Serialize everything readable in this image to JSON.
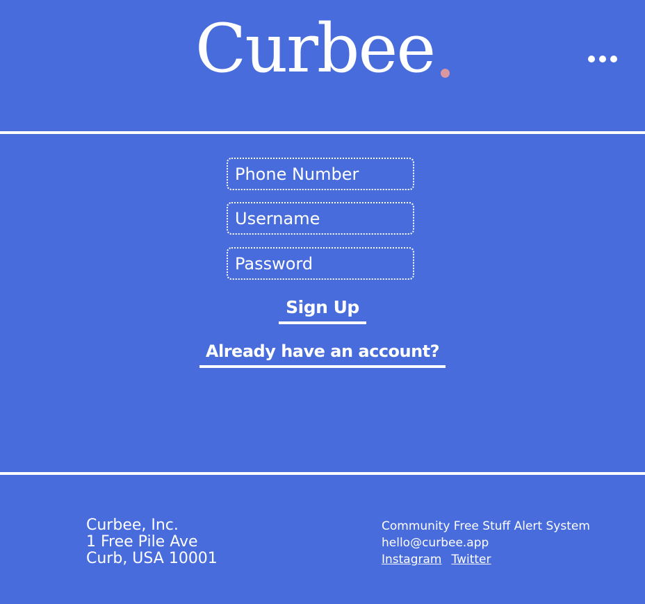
{
  "header": {
    "logo_text": "Curbee",
    "logo_dot_color": "#d9979f",
    "menu_icon": "more-horizontal-icon"
  },
  "signup_form": {
    "phone_placeholder": "Phone Number",
    "username_placeholder": "Username",
    "password_placeholder": "Password",
    "signup_label": "Sign Up",
    "login_link_label": "Already have an account?"
  },
  "footer": {
    "company_name": "Curbee, Inc.",
    "address_line1": "1 Free Pile Ave",
    "address_line2": "Curb, USA 10001",
    "tagline": "Community Free Stuff Alert System",
    "email": "hello@curbee.app",
    "social_links": [
      "Instagram",
      "Twitter"
    ]
  },
  "colors": {
    "background": "#486cdb",
    "foreground": "#ffffff",
    "accent": "#d9979f"
  }
}
